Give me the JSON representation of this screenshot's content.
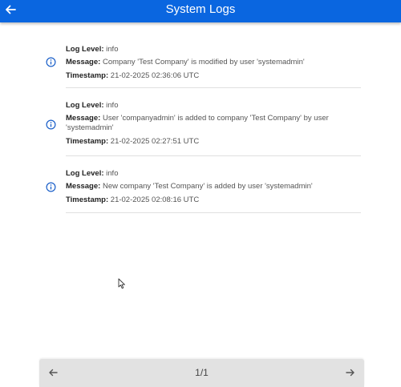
{
  "header": {
    "title": "System Logs",
    "back_icon": "arrow-left-icon"
  },
  "labels": {
    "level": "Log Level:",
    "message": "Message:",
    "timestamp": "Timestamp:"
  },
  "logs": [
    {
      "level": "info",
      "message": "Company 'Test Company' is modified by user 'systemadmin'",
      "timestamp": "21-02-2025 02:36:06 UTC",
      "icon": "info-icon"
    },
    {
      "level": "info",
      "message_line1": "User 'companyadmin' is added to company 'Test Company' by user",
      "message_line2": "'systemadmin'",
      "timestamp": "21-02-2025 02:27:51 UTC",
      "icon": "info-icon"
    },
    {
      "level": "info",
      "message": "New company 'Test Company' is added by user 'systemadmin'",
      "timestamp": "21-02-2025 02:08:16 UTC",
      "icon": "info-icon"
    }
  ],
  "pagination": {
    "page_text": "1/1",
    "prev_icon": "arrow-left-icon",
    "next_icon": "arrow-right-icon"
  },
  "colors": {
    "header_bg": "#0a66e0",
    "info_icon": "#1a5fc9",
    "pager_bg": "#e2e2e2"
  }
}
